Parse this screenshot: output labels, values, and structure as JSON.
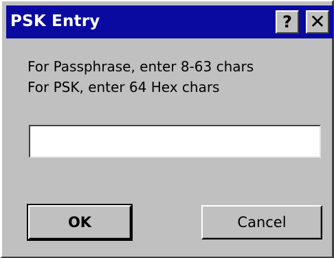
{
  "window": {
    "title": "PSK Entry",
    "help_label": "?",
    "close_label": "✕"
  },
  "dialog": {
    "line1": "For Passphrase, enter 8-63 chars",
    "line2": "For PSK, enter 64 Hex chars"
  },
  "psk_field": {
    "value": ""
  },
  "buttons": {
    "ok_label": "OK",
    "cancel_label": "Cancel"
  },
  "icons": {
    "help": "help-icon",
    "close": "close-icon"
  },
  "colors": {
    "titlebar": "#0a0aa0",
    "window_face": "#c0c0c0"
  }
}
